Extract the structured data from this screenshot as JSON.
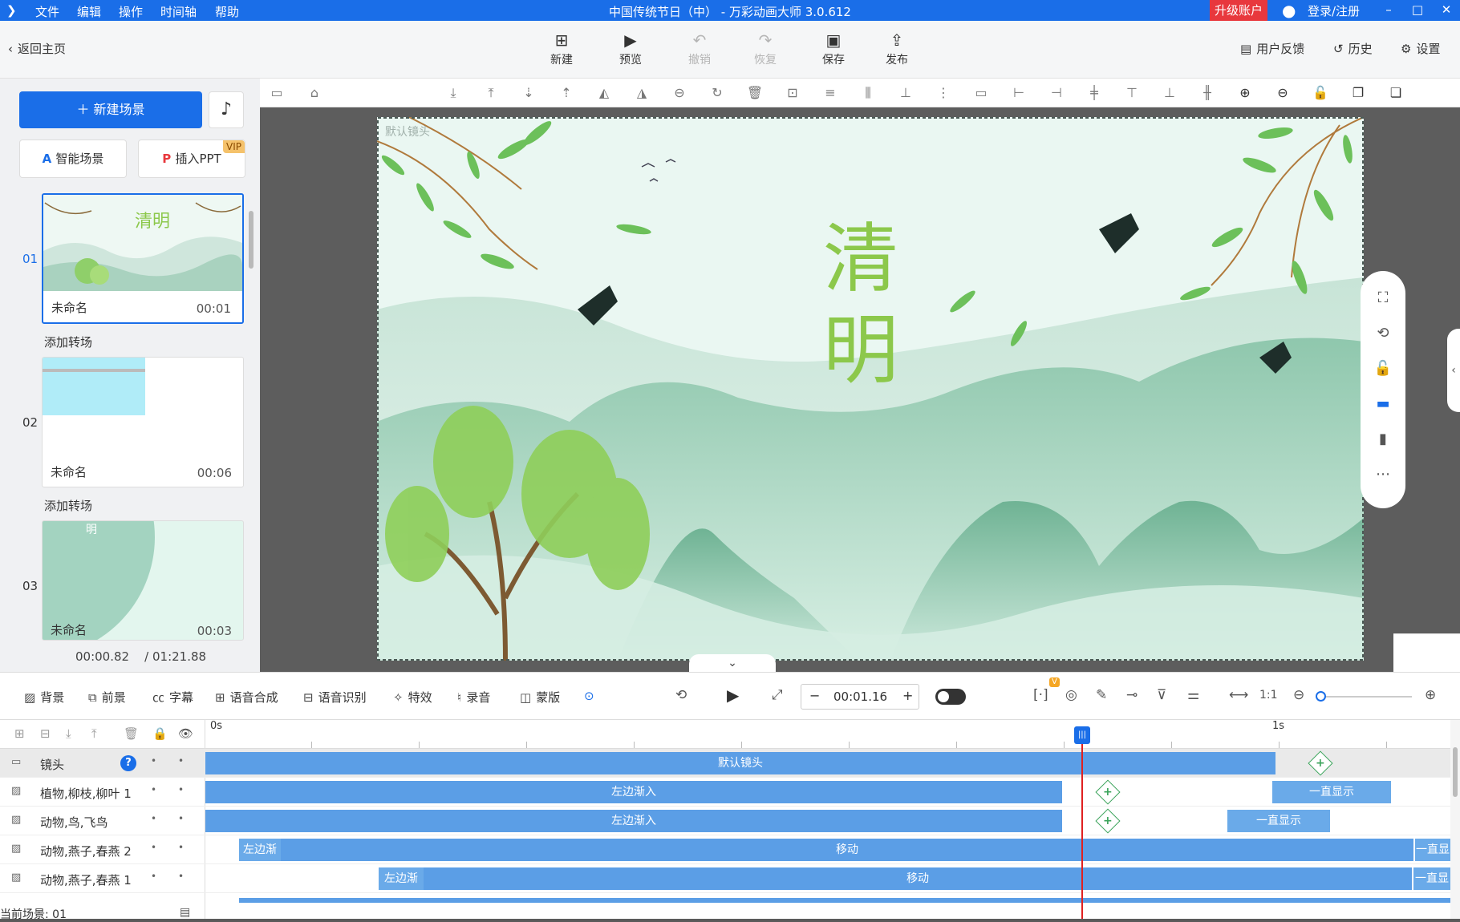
{
  "app": {
    "title": "中国传统节日（中）  - 万彩动画大师 3.0.612",
    "menu": [
      "文件",
      "编辑",
      "操作",
      "时间轴",
      "帮助"
    ],
    "upgrade": "升级账户",
    "login": "登录/注册"
  },
  "toolbar": {
    "back": "返回主页",
    "new": "新建",
    "preview": "预览",
    "undo": "撤销",
    "redo": "恢复",
    "save": "保存",
    "publish": "发布",
    "feedback": "用户反馈",
    "history": "历史",
    "settings": "设置"
  },
  "left": {
    "new_scene": "新建场景",
    "smart_scene": "智能场景",
    "insert_ppt": "插入PPT",
    "vip": "VIP",
    "scenes": [
      {
        "num": "01",
        "name": "未命名",
        "dur": "00:01",
        "title_text": "清明"
      },
      {
        "num": "02",
        "name": "未命名",
        "dur": "00:06"
      },
      {
        "num": "03",
        "name": "未命名",
        "dur": "00:03",
        "title_text": "明"
      }
    ],
    "add_transition": "添加转场",
    "current_time": "00:00.82",
    "total_time": "/ 01:21.88"
  },
  "stage": {
    "camera_label": "默认镜头",
    "title_char_1": "清",
    "title_char_2": "明"
  },
  "timeline_tools": {
    "background": "背景",
    "foreground": "前景",
    "subtitle": "字幕",
    "tts": "语音合成",
    "asr": "语音识别",
    "effects": "特效",
    "record": "录音",
    "mask": "蒙版",
    "time": "00:01.16",
    "v_badge": "V"
  },
  "timeline": {
    "ruler": {
      "start": "0s",
      "mark": "1s"
    },
    "tracks": [
      {
        "name": "镜头"
      },
      {
        "name": "植物,柳枝,柳叶 1"
      },
      {
        "name": "动物,鸟,飞鸟"
      },
      {
        "name": "动物,燕子,春燕 2"
      },
      {
        "name": "动物,燕子,春燕 1"
      }
    ],
    "bars": {
      "camera": "默认镜头",
      "fade_left": "左边渐入",
      "fade_left_short": "左边渐",
      "always_show": "一直显示",
      "always_short": "一直显",
      "move": "移动"
    },
    "current_scene": "当前场景: 01"
  }
}
